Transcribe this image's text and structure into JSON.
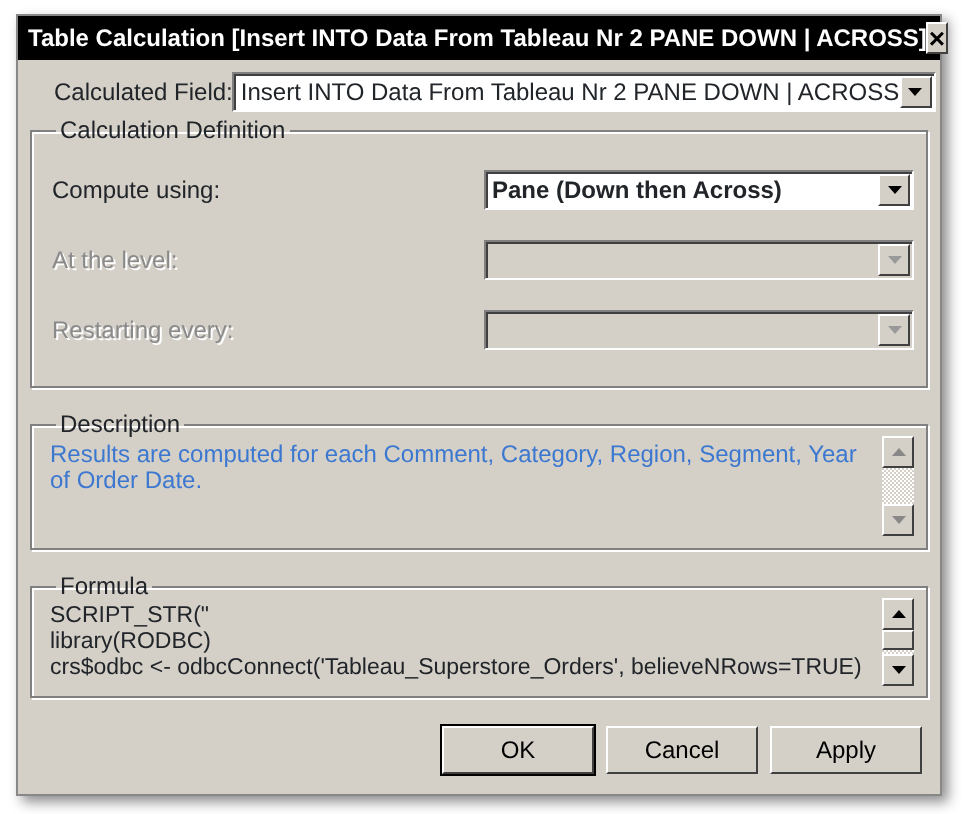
{
  "window": {
    "title": "Table Calculation [Insert INTO Data From Tableau Nr 2 PANE DOWN | ACROSS]",
    "close": "×"
  },
  "calculated_field": {
    "label": "Calculated Field:",
    "value": "Insert INTO Data From Tableau Nr 2 PANE DOWN | ACROSS"
  },
  "calculation_definition": {
    "title": "Calculation Definition",
    "rows": [
      {
        "label": "Compute using:",
        "value": "Pane (Down then Across)",
        "disabled": false
      },
      {
        "label": "At the level:",
        "disabled": true
      },
      {
        "label": "Restarting every:",
        "disabled": true
      }
    ]
  },
  "description": {
    "title": "Description",
    "text": "Results are computed for each Comment, Category, Region, Segment, Year of Order Date."
  },
  "formula": {
    "title": "Formula",
    "lines": [
      "SCRIPT_STR(\"",
      "library(RODBC)",
      "crs$odbc <- odbcConnect('Tableau_Superstore_Orders', believeNRows=TRUE)"
    ]
  },
  "buttons": [
    {
      "label": "OK",
      "default": true
    },
    {
      "label": "Cancel",
      "default": false
    },
    {
      "label": "Apply",
      "default": false
    }
  ]
}
